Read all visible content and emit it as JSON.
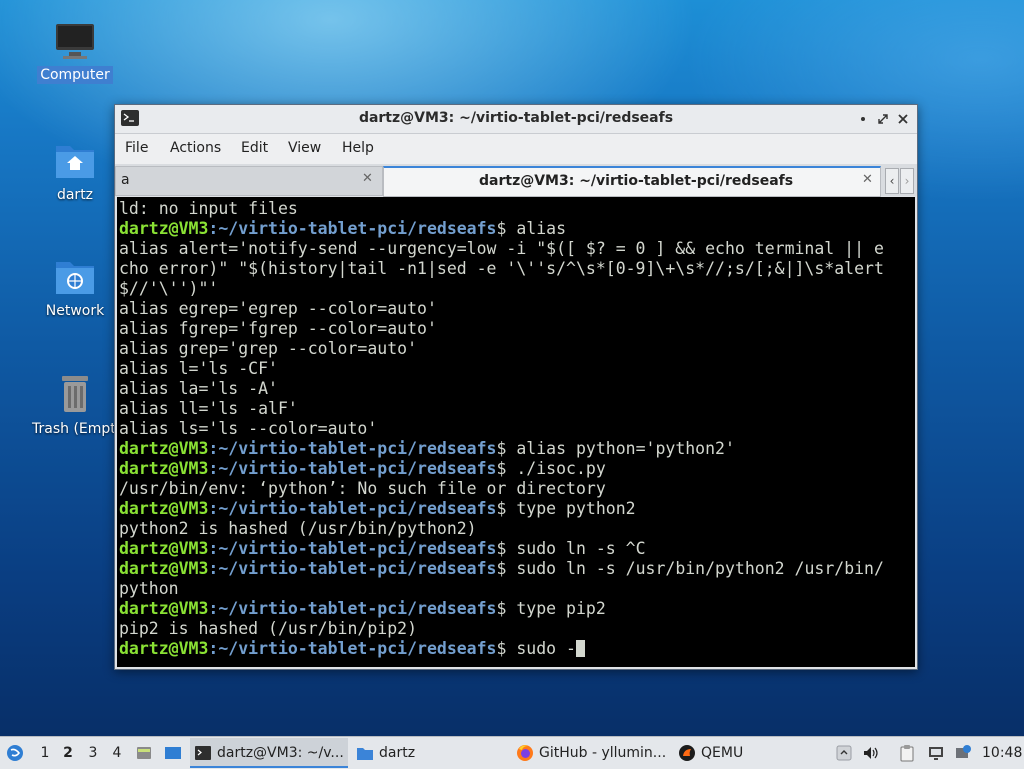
{
  "desktop": {
    "icons": [
      {
        "label": "Computer",
        "icon": "computer-icon"
      },
      {
        "label": "dartz",
        "icon": "home-folder-icon"
      },
      {
        "label": "Network",
        "icon": "network-folder-icon"
      },
      {
        "label": "Trash (Empty)",
        "icon": "trash-icon"
      }
    ]
  },
  "window": {
    "title": "dartz@VM3: ~/virtio-tablet-pci/redseafs",
    "menu": [
      "File",
      "Actions",
      "Edit",
      "View",
      "Help"
    ],
    "tabs": [
      {
        "label": "a",
        "active": false
      },
      {
        "label": "dartz@VM3: ~/virtio-tablet-pci/redseafs",
        "active": true
      }
    ],
    "prompt_user": "dartz@VM3",
    "prompt_path": ":~/virtio-tablet-pci/redseafs",
    "prompt_symbol": "$ ",
    "lines": [
      {
        "type": "output",
        "text": "ld: no input files"
      },
      {
        "type": "prompt",
        "text": "alias"
      },
      {
        "type": "output",
        "text": "alias alert='notify-send --urgency=low -i \"$([ $? = 0 ] && echo terminal || e"
      },
      {
        "type": "output",
        "text": "cho error)\" \"$(history|tail -n1|sed -e '\\''s/^\\s*[0-9]\\+\\s*//;s/[;&|]\\s*alert"
      },
      {
        "type": "output",
        "text": "$//'\\'')\"'"
      },
      {
        "type": "output",
        "text": "alias egrep='egrep --color=auto'"
      },
      {
        "type": "output",
        "text": "alias fgrep='fgrep --color=auto'"
      },
      {
        "type": "output",
        "text": "alias grep='grep --color=auto'"
      },
      {
        "type": "output",
        "text": "alias l='ls -CF'"
      },
      {
        "type": "output",
        "text": "alias la='ls -A'"
      },
      {
        "type": "output",
        "text": "alias ll='ls -alF'"
      },
      {
        "type": "output",
        "text": "alias ls='ls --color=auto'"
      },
      {
        "type": "prompt",
        "text": "alias python='python2'"
      },
      {
        "type": "prompt",
        "text": "./isoc.py"
      },
      {
        "type": "output",
        "text": "/usr/bin/env: ‘python’: No such file or directory"
      },
      {
        "type": "prompt",
        "text": "type python2"
      },
      {
        "type": "output",
        "text": "python2 is hashed (/usr/bin/python2)"
      },
      {
        "type": "prompt",
        "text": "sudo ln -s ^C"
      },
      {
        "type": "prompt",
        "text": "sudo ln -s /usr/bin/python2 /usr/bin/"
      },
      {
        "type": "output",
        "text": "python"
      },
      {
        "type": "prompt",
        "text": "type pip2"
      },
      {
        "type": "output",
        "text": "pip2 is hashed (/usr/bin/pip2)"
      },
      {
        "type": "prompt",
        "text": "sudo -",
        "cursor": true
      }
    ]
  },
  "taskbar": {
    "workspaces": [
      "1",
      "2",
      "3",
      "4"
    ],
    "active_workspace": "2",
    "tasks": [
      {
        "label": "dartz@VM3: ~/v...",
        "icon": "terminal-icon",
        "active": true
      },
      {
        "label": "dartz",
        "icon": "folder-icon",
        "active": false
      },
      {
        "label": "GitHub - yllumin...",
        "icon": "firefox-icon",
        "active": false
      },
      {
        "label": "QEMU",
        "icon": "qemu-icon",
        "active": false
      }
    ],
    "clock": "10:48"
  }
}
